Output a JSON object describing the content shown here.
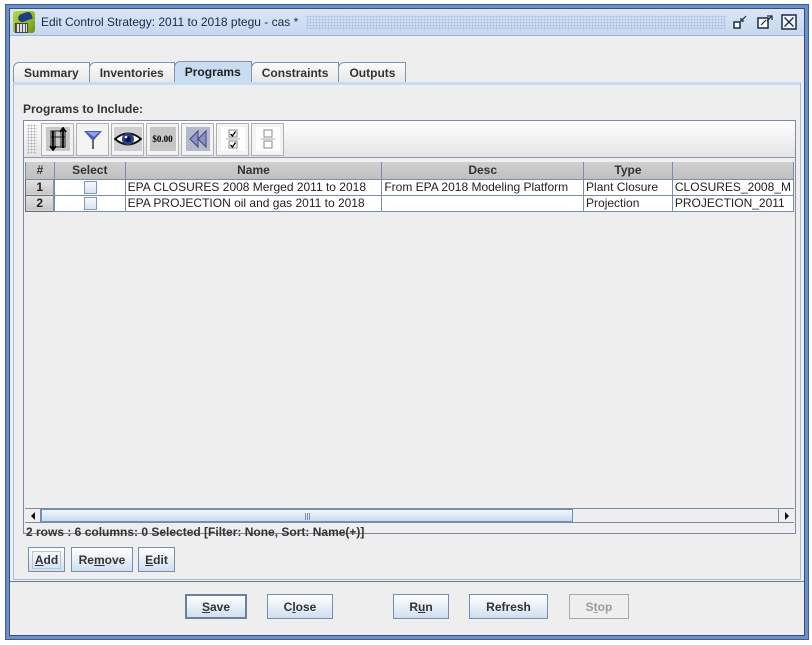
{
  "window": {
    "title": "Edit Control Strategy: 2011 to 2018 ptegu - cas *",
    "controls": [
      "minimize-icon",
      "maximize-icon",
      "close-icon"
    ]
  },
  "tabs": [
    {
      "label": "Summary",
      "active": false
    },
    {
      "label": "Inventories",
      "active": false
    },
    {
      "label": "Programs",
      "active": true
    },
    {
      "label": "Constraints",
      "active": false
    },
    {
      "label": "Outputs",
      "active": false
    }
  ],
  "programs": {
    "section_label": "Programs to Include:",
    "toolbar": [
      {
        "name": "sort-icon",
        "tooltip": "Sort"
      },
      {
        "name": "filter-icon",
        "tooltip": "Filter"
      },
      {
        "name": "view-icon",
        "tooltip": "Show/Hide Columns"
      },
      {
        "name": "format-icon",
        "tooltip": "Format",
        "text": "$0.00"
      },
      {
        "name": "reset-icon",
        "tooltip": "Reset"
      },
      {
        "name": "select-all-icon",
        "tooltip": "Select All"
      },
      {
        "name": "clear-all-icon",
        "tooltip": "Clear All"
      }
    ],
    "table": {
      "columns": [
        "#",
        "Select",
        "Name",
        "Desc",
        "Type",
        ""
      ],
      "rows": [
        {
          "num": "1",
          "selected": false,
          "name": "EPA CLOSURES 2008 Merged 2011 to 2018",
          "desc": "From EPA 2018 Modeling Platform",
          "type": "Plant Closure",
          "extra": "CLOSURES_2008_M"
        },
        {
          "num": "2",
          "selected": false,
          "name": "EPA PROJECTION oil and gas 2011 to 2018",
          "desc": "",
          "type": "Projection",
          "extra": "PROJECTION_2011"
        }
      ]
    },
    "status": "2 rows : 6 columns: 0 Selected [Filter: None, Sort: Name(+)]",
    "buttons": {
      "add": {
        "pre": "",
        "mnemonic": "A",
        "post": "dd"
      },
      "remove": {
        "pre": "Re",
        "mnemonic": "m",
        "post": "ove"
      },
      "edit": {
        "pre": "",
        "mnemonic": "E",
        "post": "dit"
      }
    }
  },
  "footer": {
    "save": {
      "pre": "",
      "mnemonic": "S",
      "post": "ave"
    },
    "close": {
      "pre": "C",
      "mnemonic": "l",
      "post": "ose"
    },
    "run": {
      "pre": "R",
      "mnemonic": "u",
      "post": "n"
    },
    "refresh": {
      "label": "Refresh"
    },
    "stop": {
      "pre": "S",
      "mnemonic": "t",
      "post": "op",
      "disabled": true
    }
  }
}
